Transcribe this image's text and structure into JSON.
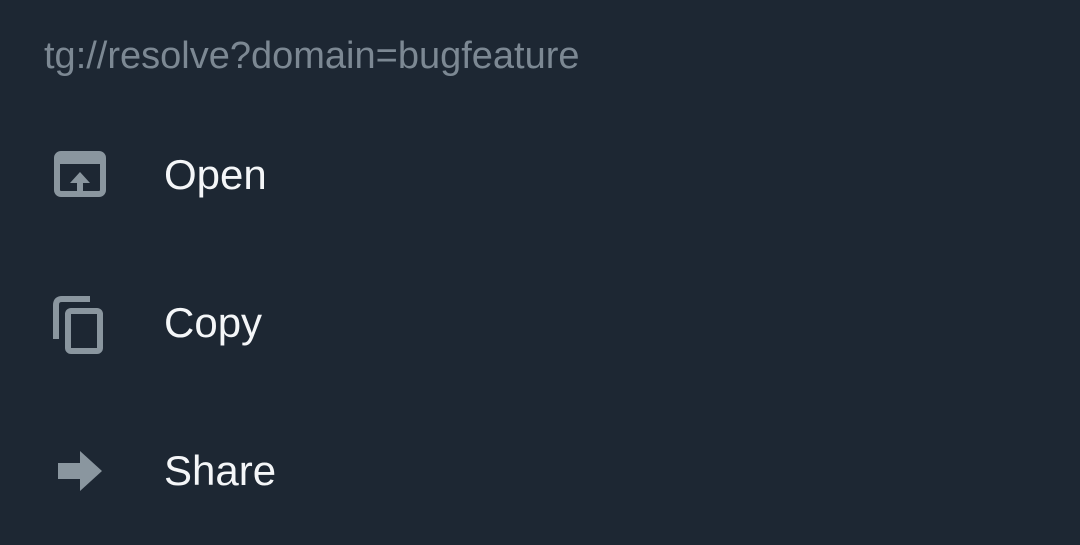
{
  "sheet": {
    "title": "tg://resolve?domain=bugfeature",
    "icon_color": "#8a969f",
    "background": "#1d2733",
    "items": [
      {
        "label": "Open",
        "icon": "open-in-icon"
      },
      {
        "label": "Copy",
        "icon": "copy-icon"
      },
      {
        "label": "Share",
        "icon": "share-arrow-icon"
      }
    ]
  }
}
